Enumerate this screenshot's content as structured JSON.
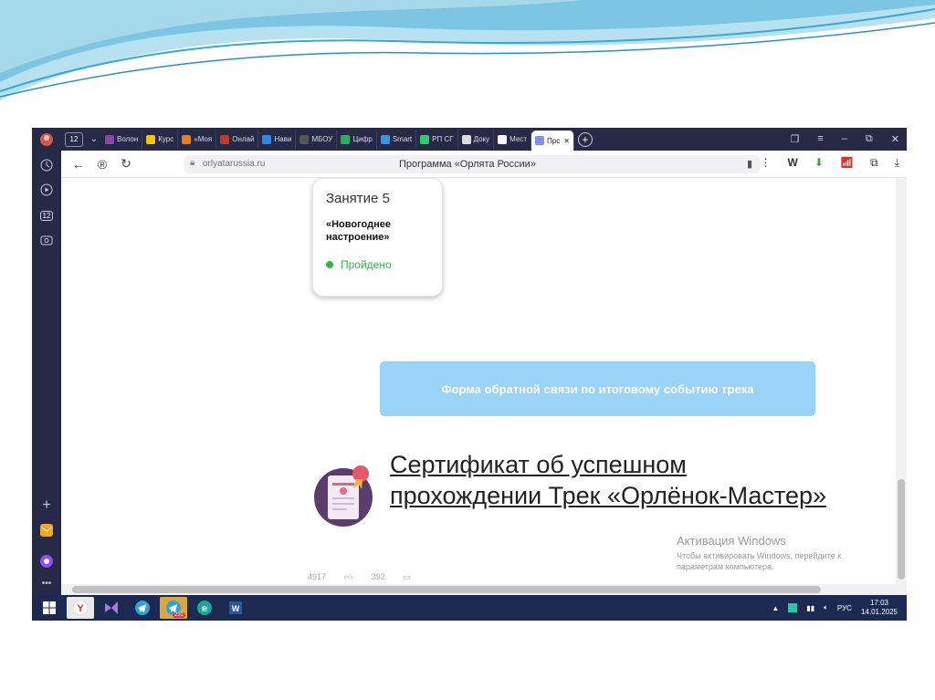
{
  "browser": {
    "tab_count": "12",
    "tabs": [
      {
        "label": "Волон",
        "color": "#8e44ad"
      },
      {
        "label": "Курс",
        "color": "#f1c40f"
      },
      {
        "label": "«Моя",
        "color": "#e67e22"
      },
      {
        "label": "Онлай",
        "color": "#c0392b"
      },
      {
        "label": "Нави",
        "color": "#2e86de"
      },
      {
        "label": "МБОУ",
        "color": "#555555"
      },
      {
        "label": "Цифр",
        "color": "#27ae60"
      },
      {
        "label": "Smart",
        "color": "#3498db"
      },
      {
        "label": "РП СГ",
        "color": "#2ecc71"
      },
      {
        "label": "Доку",
        "color": "#dddddd"
      },
      {
        "label": "Мест",
        "color": "#ffffff"
      },
      {
        "label": "Прс",
        "color": "#7f8ff4",
        "active": true
      }
    ],
    "url_host": "orlyatarussia.ru",
    "page_title": "Программа «Орлята России»"
  },
  "page": {
    "lesson_card": {
      "title": "Занятие 5",
      "subject": "«Новогоднее настроение»",
      "status": "Пройдено"
    },
    "feedback_button": "Форма обратной связи по итоговому событию трека",
    "certificate_link": "Сертификат об успешном прохождении Трек «Орлёнок-Мастер»",
    "likes_count": "4917",
    "comments_count": "392"
  },
  "activation": {
    "title": "Активация Windows",
    "line1": "Чтобы активировать Windows, перейдите к",
    "line2": "параметрам компьютера."
  },
  "taskbar": {
    "telegram_badge": "231",
    "lang": "РУС",
    "time": "17:03",
    "date": "14.01.2025"
  },
  "colors": {
    "sidebar_bg": "#262a47",
    "feedback_bg": "#99d3f6",
    "status_green": "#36b34a",
    "taskbar_bg": "#1c2a52"
  }
}
